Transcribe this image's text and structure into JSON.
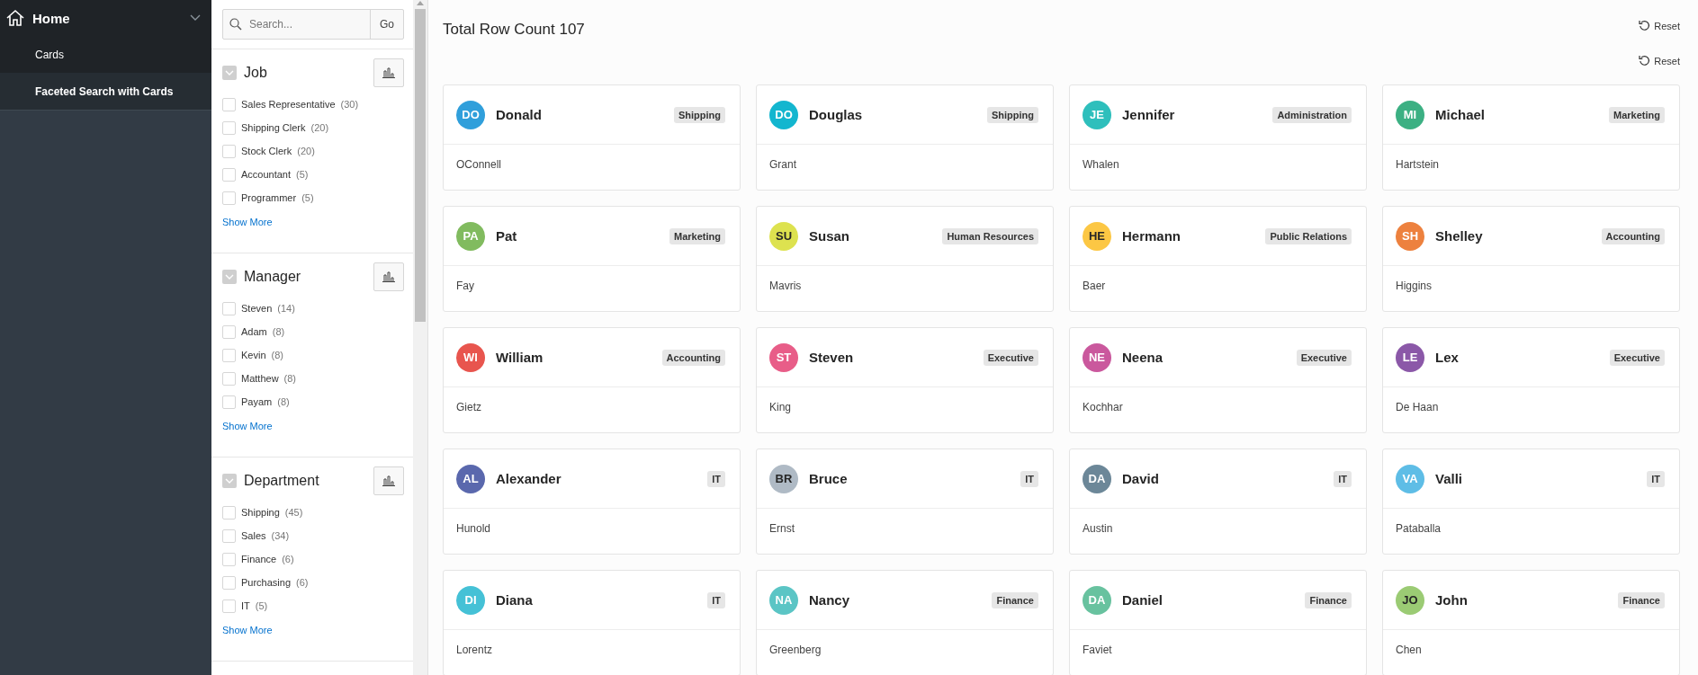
{
  "sidebar": {
    "items": [
      {
        "label": "Home",
        "expanded": true,
        "children": [
          {
            "label": "Cards",
            "selected": false
          },
          {
            "label": "Faceted Search with Cards",
            "selected": true
          }
        ]
      }
    ]
  },
  "facets_panel": {
    "search": {
      "placeholder": "Search...",
      "button": "Go"
    },
    "facets": [
      {
        "title": "Job",
        "expanded": true,
        "options": [
          {
            "label": "Sales Representative",
            "count": "(30)",
            "checked": false
          },
          {
            "label": "Shipping Clerk",
            "count": "(20)",
            "checked": false
          },
          {
            "label": "Stock Clerk",
            "count": "(20)",
            "checked": false
          },
          {
            "label": "Accountant",
            "count": "(5)",
            "checked": false
          },
          {
            "label": "Programmer",
            "count": "(5)",
            "checked": false
          }
        ],
        "show_more": "Show More"
      },
      {
        "title": "Manager",
        "expanded": true,
        "options": [
          {
            "label": "Steven",
            "count": "(14)",
            "checked": false
          },
          {
            "label": "Adam",
            "count": "(8)",
            "checked": false
          },
          {
            "label": "Kevin",
            "count": "(8)",
            "checked": false
          },
          {
            "label": "Matthew",
            "count": "(8)",
            "checked": false
          },
          {
            "label": "Payam",
            "count": "(8)",
            "checked": false
          }
        ],
        "show_more": "Show More"
      },
      {
        "title": "Department",
        "expanded": true,
        "options": [
          {
            "label": "Shipping",
            "count": "(45)",
            "checked": false
          },
          {
            "label": "Sales",
            "count": "(34)",
            "checked": false
          },
          {
            "label": "Finance",
            "count": "(6)",
            "checked": false
          },
          {
            "label": "Purchasing",
            "count": "(6)",
            "checked": false
          },
          {
            "label": "IT",
            "count": "(5)",
            "checked": false
          }
        ],
        "show_more": "Show More"
      }
    ]
  },
  "header": {
    "title": "Total Row Count 107",
    "reset_buttons": [
      "Reset",
      "Reset"
    ]
  },
  "cards": [
    {
      "initials": "DO",
      "color": "#309fdb",
      "first_name": "Donald",
      "department": "Shipping",
      "last_name": "OConnell"
    },
    {
      "initials": "DO",
      "color": "#13b6cf",
      "first_name": "Douglas",
      "department": "Shipping",
      "last_name": "Grant"
    },
    {
      "initials": "JE",
      "color": "#2ebfbc",
      "first_name": "Jennifer",
      "department": "Administration",
      "last_name": "Whalen"
    },
    {
      "initials": "MI",
      "color": "#3cb083",
      "first_name": "Michael",
      "department": "Marketing",
      "last_name": "Hartstein"
    },
    {
      "initials": "PA",
      "color": "#81bb5f",
      "first_name": "Pat",
      "department": "Marketing",
      "last_name": "Fay"
    },
    {
      "initials": "SU",
      "color": "#dde24f",
      "first_name": "Susan",
      "department": "Human Resources",
      "last_name": "Mavris"
    },
    {
      "initials": "HE",
      "color": "#fcc744",
      "first_name": "Hermann",
      "department": "Public Relations",
      "last_name": "Baer"
    },
    {
      "initials": "SH",
      "color": "#ed813e",
      "first_name": "Shelley",
      "department": "Accounting",
      "last_name": "Higgins"
    },
    {
      "initials": "WI",
      "color": "#e8554e",
      "first_name": "William",
      "department": "Accounting",
      "last_name": "Gietz"
    },
    {
      "initials": "ST",
      "color": "#e85d88",
      "first_name": "Steven",
      "department": "Executive",
      "last_name": "King"
    },
    {
      "initials": "NE",
      "color": "#ca589d",
      "first_name": "Neena",
      "department": "Executive",
      "last_name": "Kochhar"
    },
    {
      "initials": "LE",
      "color": "#8b58a8",
      "first_name": "Lex",
      "department": "Executive",
      "last_name": "De Haan"
    },
    {
      "initials": "AL",
      "color": "#5a68ad",
      "first_name": "Alexander",
      "department": "IT",
      "last_name": "Hunold"
    },
    {
      "initials": "BR",
      "color": "#afbac5",
      "first_name": "Bruce",
      "department": "IT",
      "last_name": "Ernst"
    },
    {
      "initials": "DA",
      "color": "#6c8798",
      "first_name": "David",
      "department": "IT",
      "last_name": "Austin"
    },
    {
      "initials": "VA",
      "color": "#5ebde6",
      "first_name": "Valli",
      "department": "IT",
      "last_name": "Pataballa"
    },
    {
      "initials": "DI",
      "color": "#45c1d6",
      "first_name": "Diana",
      "department": "IT",
      "last_name": "Lorentz"
    },
    {
      "initials": "NA",
      "color": "#5bc5c5",
      "first_name": "Nancy",
      "department": "Finance",
      "last_name": "Greenberg"
    },
    {
      "initials": "DA",
      "color": "#68c29f",
      "first_name": "Daniel",
      "department": "Finance",
      "last_name": "Faviet"
    },
    {
      "initials": "JO",
      "color": "#9bcb74",
      "first_name": "John",
      "department": "Finance",
      "last_name": "Chen"
    }
  ]
}
